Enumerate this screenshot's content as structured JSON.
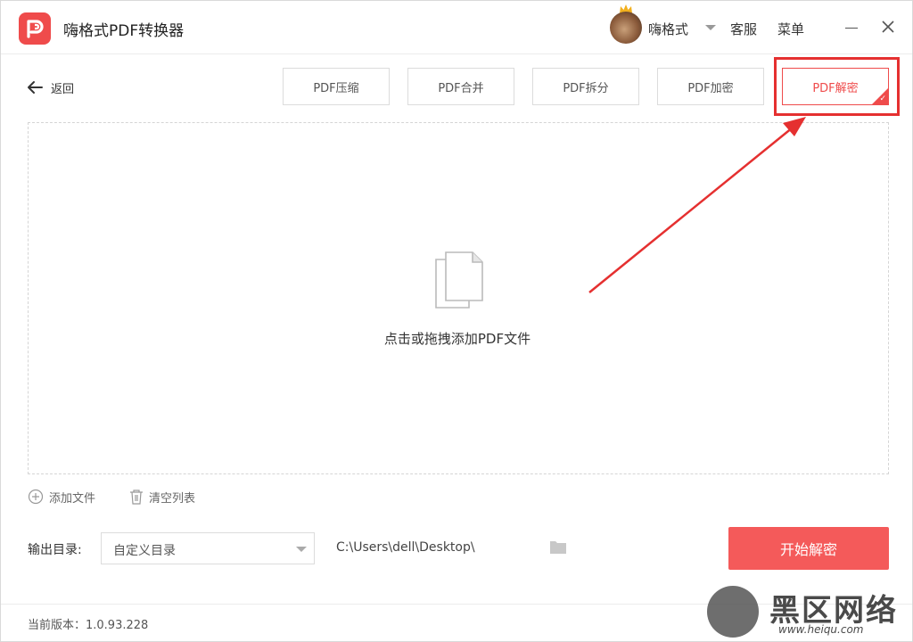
{
  "app": {
    "title": "嗨格式PDF转换器",
    "accent": "#ef4b4b"
  },
  "user": {
    "name": "嗨格式"
  },
  "header": {
    "service": "客服",
    "menu": "菜单"
  },
  "toolbar": {
    "back_label": "返回",
    "tabs": [
      {
        "label": "PDF压缩",
        "active": false
      },
      {
        "label": "PDF合并",
        "active": false
      },
      {
        "label": "PDF拆分",
        "active": false
      },
      {
        "label": "PDF加密",
        "active": false
      },
      {
        "label": "PDF解密",
        "active": true
      }
    ]
  },
  "dropzone": {
    "prompt": "点击或拖拽添加PDF文件"
  },
  "file_actions": {
    "add": "添加文件",
    "clear": "清空列表"
  },
  "output": {
    "label": "输出目录:",
    "select_value": "自定义目录",
    "path": "C:\\Users\\dell\\Desktop\\"
  },
  "start_button": "开始解密",
  "footer": {
    "version": "当前版本：1.0.93.228"
  },
  "watermark": {
    "title": "黑区网络",
    "url": "www.heiqu.com"
  },
  "icons": [
    "app-logo-icon",
    "crown-icon",
    "back-arrow-icon",
    "document-icon",
    "add-circle-icon",
    "trash-icon",
    "folder-icon",
    "minimize-icon",
    "close-icon"
  ]
}
